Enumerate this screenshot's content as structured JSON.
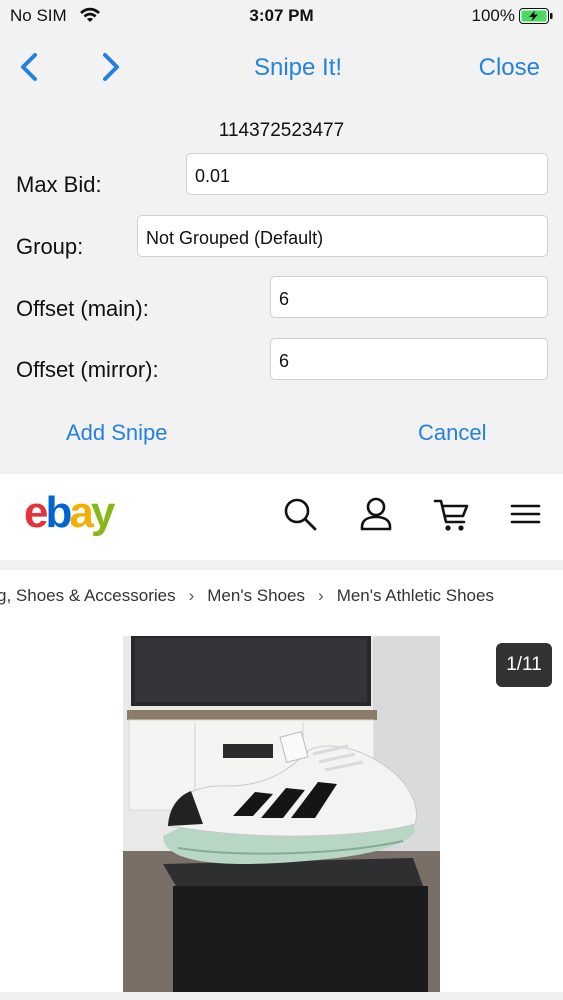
{
  "status_bar": {
    "carrier": "No SIM",
    "time": "3:07 PM",
    "battery_percent": "100%"
  },
  "snipe_panel": {
    "title": "Snipe It!",
    "close_label": "Close",
    "item_id": "114372523477",
    "fields": {
      "max_bid": {
        "label": "Max Bid:",
        "value": "0.01"
      },
      "group": {
        "label": "Group:",
        "value": "Not Grouped (Default)"
      },
      "offset_main": {
        "label": "Offset (main):",
        "value": "6"
      },
      "offset_mirror": {
        "label": "Offset (mirror):",
        "value": "6"
      }
    },
    "add_label": "Add Snipe",
    "cancel_label": "Cancel"
  },
  "ebay_header": {
    "logo_letters": [
      "e",
      "b",
      "a",
      "y"
    ],
    "logo_colors": [
      "#e53238",
      "#0064d2",
      "#f5af02",
      "#86b817"
    ],
    "icons": [
      "search-icon",
      "account-icon",
      "cart-icon",
      "menu-icon"
    ]
  },
  "breadcrumb": [
    "g, Shoes & Accessories",
    "Men's Shoes",
    "Men's Athletic Shoes"
  ],
  "gallery": {
    "counter": "1/11"
  },
  "colors": {
    "accent": "#2382de",
    "panel_bg": "#f2f2f2",
    "battery": "#4cd964"
  }
}
